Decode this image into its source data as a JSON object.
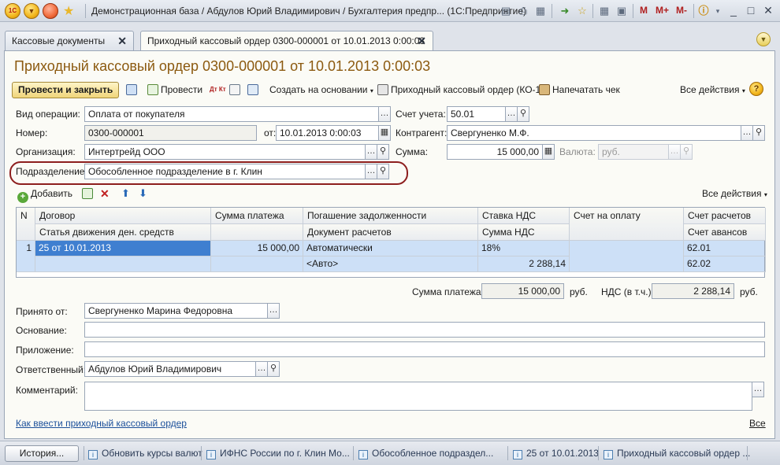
{
  "window": {
    "title": "Демонстрационная база / Абдулов Юрий Владимирович / Бухгалтерия предпр... (1С:Предприятие)",
    "logo_text": "1С",
    "memory_buttons": [
      "M",
      "M+",
      "M-"
    ]
  },
  "tabs": [
    {
      "label": "Кассовые документы"
    },
    {
      "label": "Приходный кассовый ордер 0300-000001 от 10.01.2013 0:00:03"
    }
  ],
  "document": {
    "title": "Приходный кассовый ордер 0300-000001 от 10.01.2013 0:00:03"
  },
  "toolbar": {
    "post_close": "Провести и закрыть",
    "post": "Провести",
    "create_based": "Создать на основании",
    "print_pko": "Приходный кассовый ордер (КО-1)",
    "print_check": "Напечатать чек",
    "all_actions": "Все действия",
    "dtkt_icon_text": "Дт Кт"
  },
  "form": {
    "operation_label": "Вид операции:",
    "operation_value": "Оплата от покупателя",
    "number_label": "Номер:",
    "number_value": "0300-000001",
    "date_label": "от:",
    "date_value": "10.01.2013  0:00:03",
    "org_label": "Организация:",
    "org_value": "Интертрейд ООО",
    "dept_label": "Подразделение:",
    "dept_value": "Обособленное подразделение в г. Клин",
    "account_label": "Счет учета:",
    "account_value": "50.01",
    "contractor_label": "Контрагент:",
    "contractor_value": "Свергуненко М.Ф.",
    "sum_label": "Сумма:",
    "sum_value": "15 000,00",
    "currency_label": "Валюта:",
    "currency_value": "руб."
  },
  "table_toolbar": {
    "add": "Добавить",
    "all_actions": "Все действия"
  },
  "table": {
    "headers_top": [
      "N",
      "Договор",
      "Сумма платежа",
      "Погашение задолженности",
      "Ставка НДС",
      "Счет на оплату",
      "Счет расчетов"
    ],
    "headers_bottom": [
      "Статья движения ден. средств",
      "Документ расчетов",
      "Сумма НДС",
      "Счет авансов"
    ],
    "row": {
      "n": "1",
      "contract": "25 от 10.01.2013",
      "sum": "15 000,00",
      "repayment": "Автоматически",
      "vat_rate": "18%",
      "settlement_account": "62.01",
      "settlement_doc": "<Авто>",
      "vat_sum": "2 288,14",
      "advance_account": "62.02"
    }
  },
  "totals": {
    "sum_label": "Сумма платежа:",
    "sum_value": "15 000,00",
    "sum_unit": "руб.",
    "vat_label": "НДС (в т.ч.):",
    "vat_value": "2 288,14",
    "vat_unit": "руб."
  },
  "bottom": {
    "received_label": "Принято от:",
    "received_value": "Свергуненко Марина Федоровна",
    "basis_label": "Основание:",
    "basis_value": "",
    "attachment_label": "Приложение:",
    "attachment_value": "",
    "responsible_label": "Ответственный:",
    "responsible_value": "Абдулов Юрий Владимирович",
    "comment_label": "Комментарий:",
    "comment_value": "",
    "help_link": "Как ввести приходный кассовый ордер",
    "all_link": "Все"
  },
  "statusbar": {
    "history": "История...",
    "items": [
      "Обновить курсы валют",
      "ИФНС России по г. Клин Мо...",
      "Обособленное подраздел...",
      "25 от 10.01.2013",
      "Приходный кассовый ордер ..."
    ]
  },
  "colors": {
    "title_accent": "#8c5a10",
    "highlight_oval": "#8d1e1e",
    "row_selection": "#cde0f7",
    "active_cell": "#3f7fd0"
  }
}
